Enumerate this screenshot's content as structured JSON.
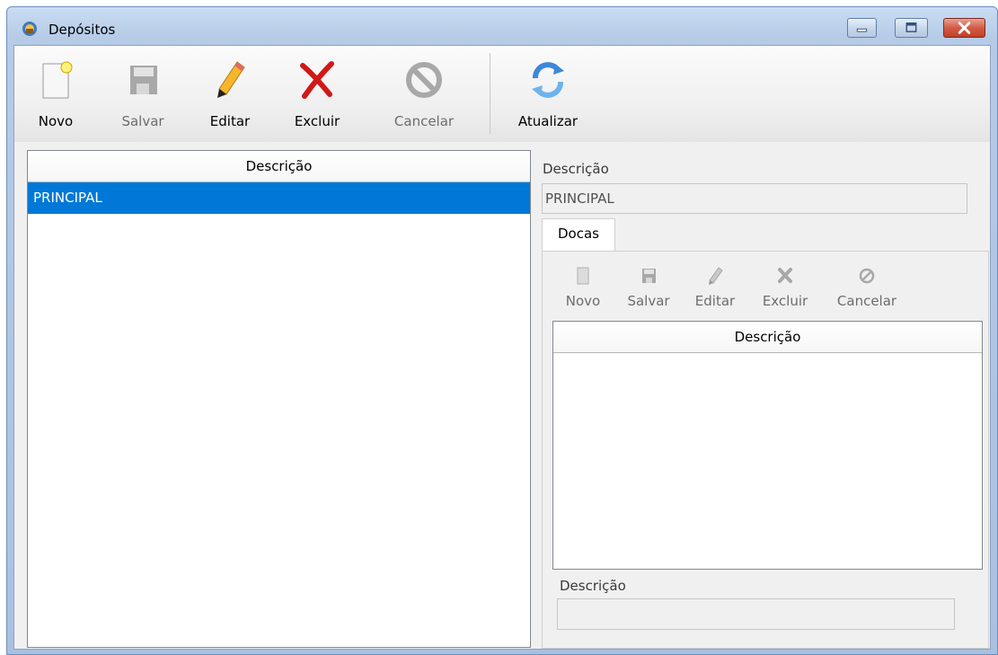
{
  "window": {
    "title": "Depósitos",
    "controls": {
      "minimize": "minimize",
      "maximize": "maximize",
      "close": "close"
    }
  },
  "toolbar": {
    "buttons": [
      {
        "label": "Novo",
        "icon": "new-document-icon",
        "enabled": true
      },
      {
        "label": "Salvar",
        "icon": "floppy-disk-icon",
        "enabled": false
      },
      {
        "label": "Editar",
        "icon": "pencil-icon",
        "enabled": true
      },
      {
        "label": "Excluir",
        "icon": "red-x-icon",
        "enabled": true
      },
      {
        "label": "Cancelar",
        "icon": "cancel-circle-icon",
        "enabled": false
      },
      {
        "label": "Atualizar",
        "icon": "refresh-icon",
        "enabled": true
      }
    ]
  },
  "list": {
    "column_header": "Descrição",
    "rows": [
      {
        "descricao": "PRINCIPAL",
        "selected": true
      }
    ]
  },
  "detail": {
    "descricao_label": "Descrição",
    "descricao_value": "PRINCIPAL",
    "tabs": [
      {
        "label": "Docas",
        "active": true
      }
    ],
    "docas": {
      "toolbar": [
        {
          "label": "Novo",
          "icon": "new-document-icon",
          "enabled": false
        },
        {
          "label": "Salvar",
          "icon": "floppy-disk-icon",
          "enabled": false
        },
        {
          "label": "Editar",
          "icon": "pencil-icon",
          "enabled": false
        },
        {
          "label": "Excluir",
          "icon": "x-icon",
          "enabled": false
        },
        {
          "label": "Cancelar",
          "icon": "cancel-circle-icon",
          "enabled": false
        }
      ],
      "column_header": "Descrição",
      "rows": [],
      "descricao_label": "Descrição",
      "descricao_value": ""
    }
  },
  "colors": {
    "selection": "#0078d7",
    "disabled_text": "#6d6d6d",
    "titlebar": "#b5cbe6"
  }
}
